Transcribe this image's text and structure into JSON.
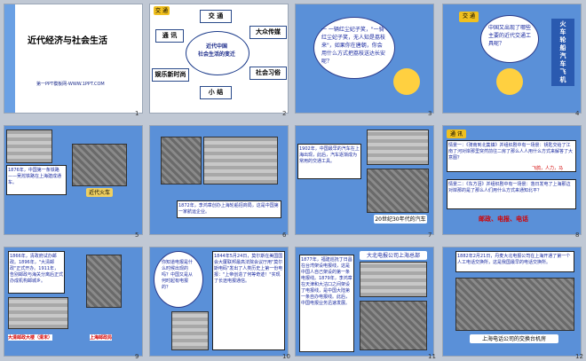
{
  "slides": [
    {
      "num": "1",
      "title": "近代经济与社会生活",
      "subtitle": "第一PPT模板网-WWW.1PPT.COM"
    },
    {
      "num": "2",
      "center": "近代中国\n社会生活的变迁",
      "n1": "交 通",
      "n2": "大众传媒",
      "n3": "通 讯",
      "n4": "娱乐新时尚",
      "n5": "社会习俗",
      "n6": "小 结",
      "badge": "交 通"
    },
    {
      "num": "3",
      "bubble": "一 一辆红尘妃子笑，\"一骑红尘妃子笑，无人知是荔枝来\"，如果你在唐朝，你会用什么方式把荔枝送达长安呢？"
    },
    {
      "num": "4",
      "badge": "交 通",
      "bubble": "中国又出现了哪些主要的近代交通工具呢？",
      "side": "火\n车\n轮\n船\n汽\n车\n飞\n机"
    },
    {
      "num": "5",
      "caption": "1876年，中国第一条铁路——吴淞铁路在上海建成通车。",
      "tag": "近代火车"
    },
    {
      "num": "6",
      "caption": "1872年，李鸿章创办上海轮船招商局，这是中国第一家航运企业。"
    },
    {
      "num": "7",
      "caption": "1902年，中国最早的汽车在上海出现，此后，汽车逐渐成为常用的交通工具。",
      "tag": "20世纪30年代的汽车"
    },
    {
      "num": "8",
      "badge": "通 讯",
      "q1": "情景一：《骑南到北集镇》并组织剧中有一场景：钥匙交给了江南了河对岸那里突然前往二房了那么人人用什么方式来解答了大意图？",
      "a1": "飞鸽，人力，马",
      "q2": "情景二：《东方泪》并组织剧中有一场景：落日发电了上海那边对岸那的是了那么人们用什么方式来通知北平？",
      "a2": "邮政、电报、电话"
    },
    {
      "num": "9",
      "caption": "1866年，清政府试办邮政。1896年，\"大清邮政\"正式开办。1911年，告别邮政与海关分离后正式办成机构邮城乡。",
      "p1": "大清邮政大楼（清末）",
      "p2": "上海邮政局"
    },
    {
      "num": "10",
      "bubble": "你知道电报是什么时候出现的吗？中国又是从何时起有电报的？",
      "caption": "1844年5月24日，莫尔斯在美国国会大厦联邦最高法院会议厅用\"莫尔斯电码\"发出了人类历史上第一份电报：\"上帝创造了何等奇迹！\"实现了长途电报通信。"
    },
    {
      "num": "11",
      "caption": "1877年，福建巡抚丁日昌在台湾架设电报线，这是中国人自己架设的第一条电报线。1879年，李鸿章在天津和大沽口之间架设了电报线，是中国大陆第一条自办电报线。此后，中国电报业务迅速发展。",
      "tag": "大北电报公司上海总部"
    },
    {
      "num": "12",
      "caption": "1882年2月21日，丹麦大北电报公司在上海开通了第一个人工电话交换所，这是我国最早的电话交换所。",
      "photo": "上海电话公司的交换台机房"
    }
  ]
}
